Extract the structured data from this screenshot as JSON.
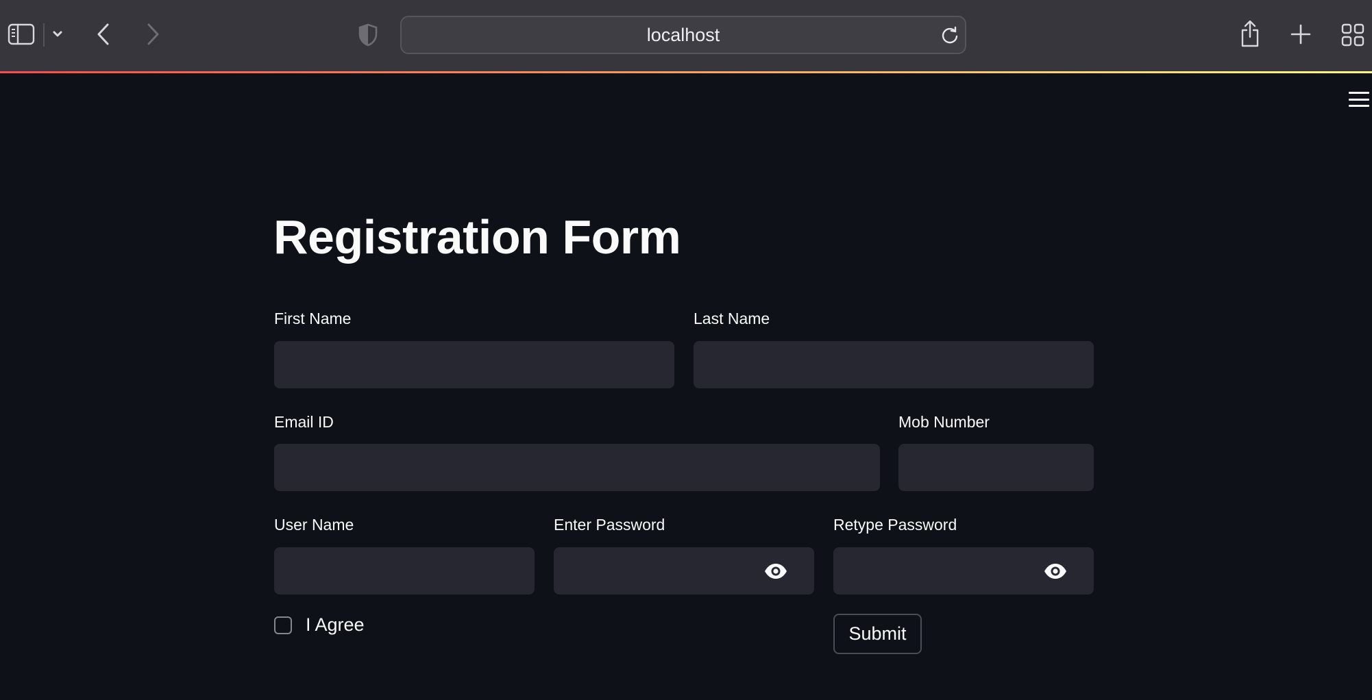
{
  "browser": {
    "address": "localhost",
    "icons": {
      "sidebar": "sidebar-icon",
      "tab_menu": "chevron-down-icon",
      "back": "chevron-left-icon",
      "forward": "chevron-right-icon",
      "privacy": "shield-icon",
      "reload": "reload-icon",
      "share": "share-icon",
      "new_tab": "plus-icon",
      "tab_overview": "grid-icon"
    }
  },
  "app": {
    "menu_icon": "hamburger-menu-icon",
    "title": "Registration Form",
    "fields": {
      "first_name": {
        "label": "First Name",
        "value": ""
      },
      "last_name": {
        "label": "Last Name",
        "value": ""
      },
      "email": {
        "label": "Email ID",
        "value": ""
      },
      "mobile": {
        "label": "Mob Number",
        "value": ""
      },
      "username": {
        "label": "User Name",
        "value": ""
      },
      "password": {
        "label": "Enter Password",
        "value": "",
        "reveal_icon": "eye-icon"
      },
      "retype_password": {
        "label": "Retype Password",
        "value": "",
        "reveal_icon": "eye-icon"
      }
    },
    "agree": {
      "label": "I Agree",
      "checked": false
    },
    "submit_label": "Submit"
  },
  "colors": {
    "page_background": "#0e1117",
    "input_background": "#262730",
    "toolbar_background": "#38363d",
    "text": "#fafafa",
    "accent": "#ff4b4b"
  }
}
